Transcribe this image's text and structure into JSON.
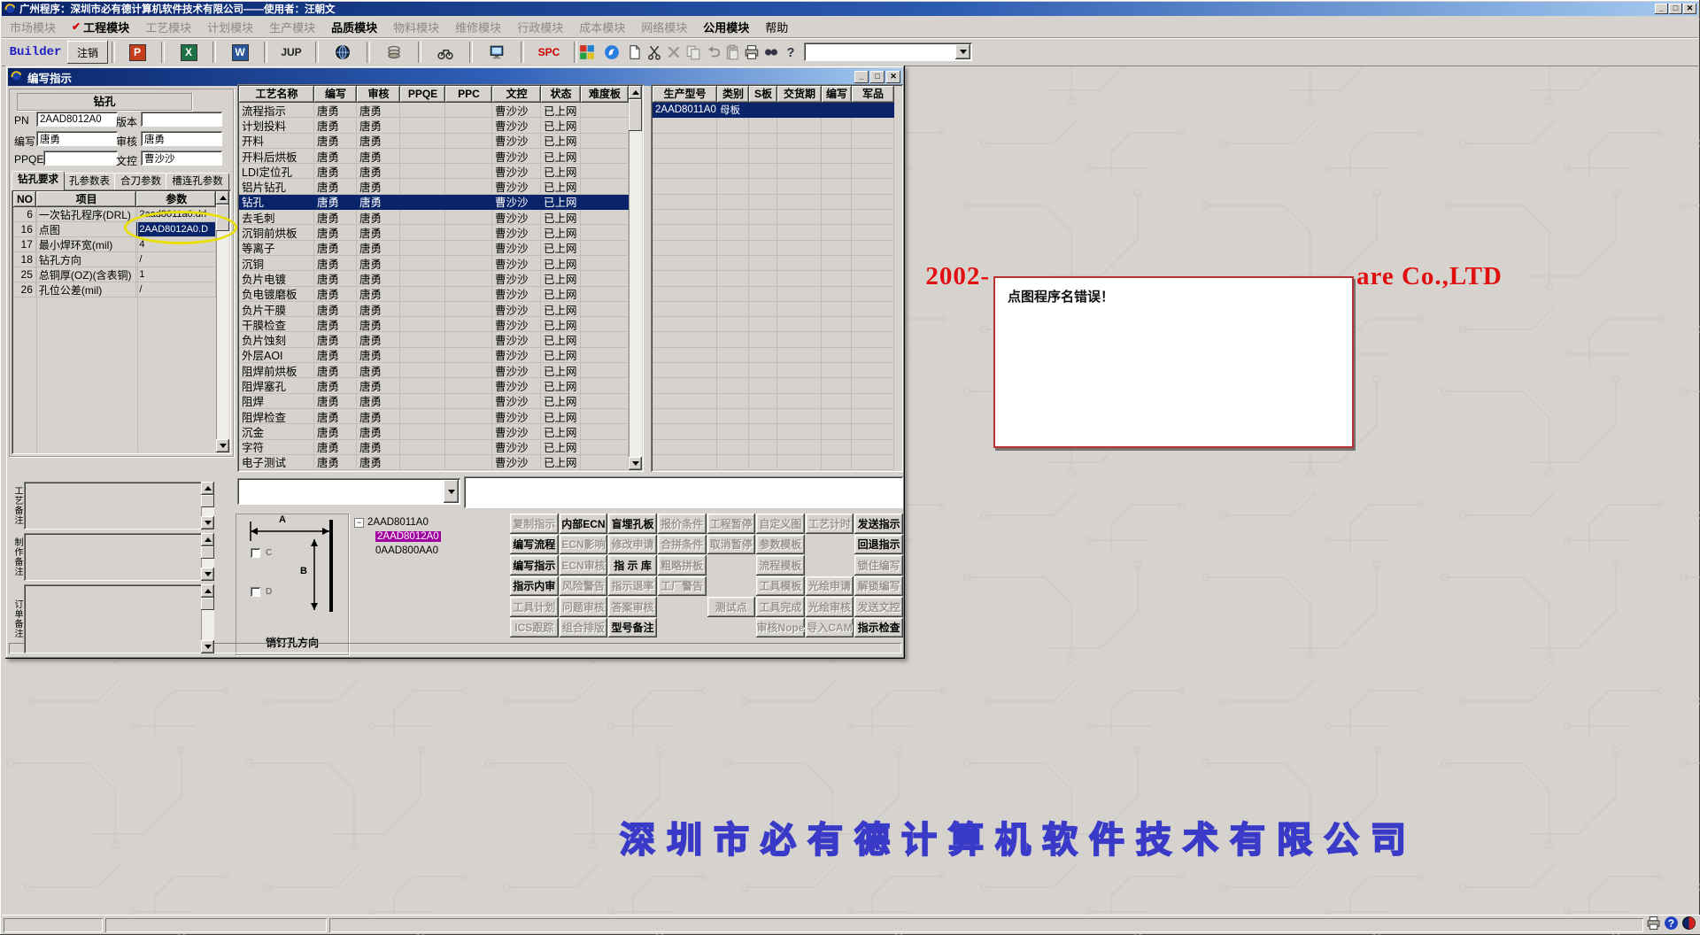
{
  "window": {
    "title": "广州程序：深圳市必有德计算机软件技术有限公司——使用者：汪朝文",
    "controls": {
      "minimize": "_",
      "maximize": "□",
      "close": "✕"
    }
  },
  "menu": {
    "items": [
      {
        "label": "市场模块",
        "enabled": false
      },
      {
        "label": "工程模块",
        "enabled": true,
        "bold": true,
        "checked": true
      },
      {
        "label": "工艺模块",
        "enabled": false
      },
      {
        "label": "计划模块",
        "enabled": false
      },
      {
        "label": "生产模块",
        "enabled": false
      },
      {
        "label": "品质模块",
        "enabled": true,
        "bold": true
      },
      {
        "label": "物料模块",
        "enabled": false
      },
      {
        "label": "维修模块",
        "enabled": false
      },
      {
        "label": "行政模块",
        "enabled": false
      },
      {
        "label": "成本模块",
        "enabled": false
      },
      {
        "label": "网络模块",
        "enabled": false
      },
      {
        "label": "公用模块",
        "enabled": true,
        "bold": true
      },
      {
        "label": "帮助",
        "enabled": true
      }
    ]
  },
  "toolbar": {
    "items": [
      {
        "kind": "label",
        "name": "builder-label",
        "label": "Builder",
        "color": "#2020c0"
      },
      {
        "kind": "button",
        "name": "logout-button",
        "label": "注销"
      },
      {
        "kind": "office",
        "name": "powerpoint-icon",
        "letter": "P",
        "bg": "#c43e1c"
      },
      {
        "kind": "office",
        "name": "excel-icon",
        "letter": "X",
        "bg": "#1e7145"
      },
      {
        "kind": "office",
        "name": "word-icon",
        "letter": "W",
        "bg": "#2b579a"
      },
      {
        "kind": "text",
        "name": "jup-button",
        "label": "JUP",
        "color": "#222222"
      },
      {
        "kind": "svg",
        "name": "globe-icon"
      },
      {
        "kind": "svg",
        "name": "coins-icon"
      },
      {
        "kind": "svg",
        "name": "motorcycle-icon"
      },
      {
        "kind": "svg",
        "name": "monitor-icon"
      },
      {
        "kind": "text",
        "name": "spc-button",
        "label": "SPC",
        "color": "#cc0000"
      },
      {
        "kind": "svg",
        "name": "palette-icon"
      },
      {
        "kind": "svg",
        "name": "messenger-icon"
      },
      {
        "kind": "svg",
        "name": "new-document-icon"
      },
      {
        "kind": "svg",
        "name": "cut-icon"
      },
      {
        "kind": "svg",
        "name": "delete-icon",
        "disabled": true
      },
      {
        "kind": "svg",
        "name": "copy-icon",
        "disabled": true
      },
      {
        "kind": "svg",
        "name": "undo-icon",
        "disabled": true
      },
      {
        "kind": "svg",
        "name": "paste-icon",
        "disabled": true
      },
      {
        "kind": "svg",
        "name": "print-icon"
      },
      {
        "kind": "svg",
        "name": "find-icon"
      },
      {
        "kind": "svg",
        "name": "help-icon"
      },
      {
        "kind": "combo",
        "name": "toolbar-combobox",
        "value": ""
      }
    ]
  },
  "dialog": {
    "title": "编写指示",
    "left": {
      "header": "钻孔",
      "fields": {
        "pn_label": "PN",
        "pn": "2AAD8012A0",
        "version_label": "版本",
        "version": "",
        "writer_label": "编写",
        "writer": "唐勇",
        "reviewer_label": "审核",
        "reviewer": "唐勇",
        "ppqe_label": "PPQE",
        "ppqe": "",
        "doccontrol_label": "文控",
        "doccontrol": "曹沙沙"
      },
      "tabs": [
        "钻孔要求",
        "孔参数表",
        "合刀参数",
        "槽连孔参数"
      ],
      "active_tab": 0,
      "param_table": {
        "headers": [
          "NO",
          "项目",
          "参数"
        ],
        "rows": [
          [
            "6",
            "一次钻孔程序(DRL)",
            "2aad8011a0.drl"
          ],
          [
            "16",
            "点图",
            "2AAD8012A0.D"
          ],
          [
            "17",
            "最小焊环宽(mil)",
            "4"
          ],
          [
            "18",
            "钻孔方向",
            "/"
          ],
          [
            "25",
            "总铜厚(OZ)(含表铜)",
            "1"
          ],
          [
            "26",
            "孔位公差(mil)",
            "/"
          ]
        ],
        "selected_index": 1
      },
      "memos": [
        {
          "label": "工艺备注",
          "value": ""
        },
        {
          "label": "制作备注",
          "value": ""
        },
        {
          "label": "订单备注",
          "value": ""
        }
      ]
    },
    "process_table": {
      "headers": [
        "工艺名称",
        "编写",
        "审核",
        "PPQE",
        "PPC",
        "文控",
        "状态",
        "难度板"
      ],
      "selected": "钻孔",
      "rows": [
        {
          "name": "流程指示",
          "writer": "唐勇",
          "reviewer": "唐勇",
          "ppqe": "",
          "ppc": "",
          "doc": "曹沙沙",
          "status": "已上网",
          "difficulty": ""
        },
        {
          "name": "计划投料",
          "writer": "唐勇",
          "reviewer": "唐勇",
          "ppqe": "",
          "ppc": "",
          "doc": "曹沙沙",
          "status": "已上网",
          "difficulty": ""
        },
        {
          "name": "开料",
          "writer": "唐勇",
          "reviewer": "唐勇",
          "ppqe": "",
          "ppc": "",
          "doc": "曹沙沙",
          "status": "已上网",
          "difficulty": ""
        },
        {
          "name": "开料后烘板",
          "writer": "唐勇",
          "reviewer": "唐勇",
          "ppqe": "",
          "ppc": "",
          "doc": "曹沙沙",
          "status": "已上网",
          "difficulty": ""
        },
        {
          "name": "LDI定位孔",
          "writer": "唐勇",
          "reviewer": "唐勇",
          "ppqe": "",
          "ppc": "",
          "doc": "曹沙沙",
          "status": "已上网",
          "difficulty": ""
        },
        {
          "name": "铝片钻孔",
          "writer": "唐勇",
          "reviewer": "唐勇",
          "ppqe": "",
          "ppc": "",
          "doc": "曹沙沙",
          "status": "已上网",
          "difficulty": ""
        },
        {
          "name": "钻孔",
          "writer": "唐勇",
          "reviewer": "唐勇",
          "ppqe": "",
          "ppc": "",
          "doc": "曹沙沙",
          "status": "已上网",
          "difficulty": ""
        },
        {
          "name": "去毛刺",
          "writer": "唐勇",
          "reviewer": "唐勇",
          "ppqe": "",
          "ppc": "",
          "doc": "曹沙沙",
          "status": "已上网",
          "difficulty": ""
        },
        {
          "name": "沉铜前烘板",
          "writer": "唐勇",
          "reviewer": "唐勇",
          "ppqe": "",
          "ppc": "",
          "doc": "曹沙沙",
          "status": "已上网",
          "difficulty": ""
        },
        {
          "name": "等离子",
          "writer": "唐勇",
          "reviewer": "唐勇",
          "ppqe": "",
          "ppc": "",
          "doc": "曹沙沙",
          "status": "已上网",
          "difficulty": ""
        },
        {
          "name": "沉铜",
          "writer": "唐勇",
          "reviewer": "唐勇",
          "ppqe": "",
          "ppc": "",
          "doc": "曹沙沙",
          "status": "已上网",
          "difficulty": ""
        },
        {
          "name": "负片电镀",
          "writer": "唐勇",
          "reviewer": "唐勇",
          "ppqe": "",
          "ppc": "",
          "doc": "曹沙沙",
          "status": "已上网",
          "difficulty": ""
        },
        {
          "name": "负电镀磨板",
          "writer": "唐勇",
          "reviewer": "唐勇",
          "ppqe": "",
          "ppc": "",
          "doc": "曹沙沙",
          "status": "已上网",
          "difficulty": ""
        },
        {
          "name": "负片干膜",
          "writer": "唐勇",
          "reviewer": "唐勇",
          "ppqe": "",
          "ppc": "",
          "doc": "曹沙沙",
          "status": "已上网",
          "difficulty": ""
        },
        {
          "name": "干膜检查",
          "writer": "唐勇",
          "reviewer": "唐勇",
          "ppqe": "",
          "ppc": "",
          "doc": "曹沙沙",
          "status": "已上网",
          "difficulty": ""
        },
        {
          "name": "负片蚀刻",
          "writer": "唐勇",
          "reviewer": "唐勇",
          "ppqe": "",
          "ppc": "",
          "doc": "曹沙沙",
          "status": "已上网",
          "difficulty": ""
        },
        {
          "name": "外层AOI",
          "writer": "唐勇",
          "reviewer": "唐勇",
          "ppqe": "",
          "ppc": "",
          "doc": "曹沙沙",
          "status": "已上网",
          "difficulty": ""
        },
        {
          "name": "阻焊前烘板",
          "writer": "唐勇",
          "reviewer": "唐勇",
          "ppqe": "",
          "ppc": "",
          "doc": "曹沙沙",
          "status": "已上网",
          "difficulty": ""
        },
        {
          "name": "阻焊塞孔",
          "writer": "唐勇",
          "reviewer": "唐勇",
          "ppqe": "",
          "ppc": "",
          "doc": "曹沙沙",
          "status": "已上网",
          "difficulty": ""
        },
        {
          "name": "阻焊",
          "writer": "唐勇",
          "reviewer": "唐勇",
          "ppqe": "",
          "ppc": "",
          "doc": "曹沙沙",
          "status": "已上网",
          "difficulty": ""
        },
        {
          "name": "阻焊检查",
          "writer": "唐勇",
          "reviewer": "唐勇",
          "ppqe": "",
          "ppc": "",
          "doc": "曹沙沙",
          "status": "已上网",
          "difficulty": ""
        },
        {
          "name": "沉金",
          "writer": "唐勇",
          "reviewer": "唐勇",
          "ppqe": "",
          "ppc": "",
          "doc": "曹沙沙",
          "status": "已上网",
          "difficulty": ""
        },
        {
          "name": "字符",
          "writer": "唐勇",
          "reviewer": "唐勇",
          "ppqe": "",
          "ppc": "",
          "doc": "曹沙沙",
          "status": "已上网",
          "difficulty": ""
        },
        {
          "name": "电子测试",
          "writer": "唐勇",
          "reviewer": "唐勇",
          "ppqe": "",
          "ppc": "",
          "doc": "曹沙沙",
          "status": "已上网",
          "difficulty": ""
        }
      ]
    },
    "model_table": {
      "headers": [
        "生产型号",
        "类别",
        "S板",
        "交货期",
        "编写",
        "军品"
      ],
      "rows": [
        {
          "model": "2AAD8011A0",
          "type": "母板",
          "sband": "",
          "delivery": "",
          "writer": "",
          "military": "",
          "selected": true
        }
      ]
    },
    "combo_value": "",
    "note_value": "",
    "diagram": {
      "label": "销钉孔方向",
      "dim_a": "A",
      "dim_b": "B",
      "checkbox_c": "C",
      "checkbox_d": "D"
    },
    "tree": {
      "root": "2AAD8011A0",
      "children": [
        {
          "label": "2AAD8012A0",
          "selected": true
        },
        {
          "label": "0AAD800AA0",
          "selected": false
        }
      ]
    },
    "actions": [
      [
        {
          "label": "复制指示",
          "enabled": false
        },
        {
          "label": "内部ECN",
          "enabled": true
        },
        {
          "label": "盲埋孔板",
          "enabled": true
        },
        {
          "label": "报价条件",
          "enabled": false
        },
        {
          "label": "工程暂停",
          "enabled": false
        },
        {
          "label": "自定义图",
          "enabled": false
        },
        {
          "label": "工艺计时",
          "enabled": false
        },
        {
          "label": "发送指示",
          "enabled": true
        }
      ],
      [
        {
          "label": "编写流程",
          "enabled": true
        },
        {
          "label": "ECN影响",
          "enabled": false
        },
        {
          "label": "修改申请",
          "enabled": false
        },
        {
          "label": "合拼条件",
          "enabled": false
        },
        {
          "label": "取消暂停",
          "enabled": false
        },
        {
          "label": "参数模板",
          "enabled": false
        },
        null,
        {
          "label": "回退指示",
          "enabled": true
        }
      ],
      [
        {
          "label": "编写指示",
          "enabled": true
        },
        {
          "label": "ECN审核",
          "enabled": false
        },
        {
          "label": "指 示 库",
          "enabled": true
        },
        {
          "label": "粗略拼板",
          "enabled": false
        },
        null,
        {
          "label": "流程模板",
          "enabled": false
        },
        null,
        {
          "label": "锁住编写",
          "enabled": false
        }
      ],
      [
        {
          "label": "指示内审",
          "enabled": true
        },
        {
          "label": "风险警告",
          "enabled": false
        },
        {
          "label": "指示退率",
          "enabled": false
        },
        {
          "label": "工厂警告",
          "enabled": false
        },
        null,
        {
          "label": "工具模板",
          "enabled": false
        },
        {
          "label": "光绘申请",
          "enabled": false
        },
        {
          "label": "解锁编写",
          "enabled": false
        }
      ],
      [
        {
          "label": "工具计划",
          "enabled": false
        },
        {
          "label": "问题审核",
          "enabled": false
        },
        {
          "label": "答案审核",
          "enabled": false
        },
        null,
        {
          "label": "测试点",
          "enabled": false
        },
        {
          "label": "工具完成",
          "enabled": false
        },
        {
          "label": "光绘审核",
          "enabled": false
        },
        {
          "label": "发送文控",
          "enabled": false
        }
      ],
      [
        {
          "label": "ICS跟踪",
          "enabled": false
        },
        {
          "label": "组合排版",
          "enabled": false
        },
        {
          "label": "型号备注",
          "enabled": true
        },
        null,
        null,
        {
          "label": "审核Nope",
          "enabled": false
        },
        {
          "label": "导入CAM",
          "enabled": false
        },
        {
          "label": "指示检查",
          "enabled": true
        }
      ]
    ]
  },
  "error_dialog": {
    "message": "点图程序名错误！"
  },
  "watermark": {
    "left": "2002-",
    "right": "are Co.,LTD",
    "color": "#e01010"
  },
  "banner": {
    "text": "深圳市必有德计算机软件技术有限公司",
    "color": "#3a3ac8"
  },
  "colors": {
    "selection": "#0a246a",
    "tree_selection": "#a000a0",
    "annotation_yellow": "#e8df00",
    "window_gray": "#d6d3ce"
  }
}
